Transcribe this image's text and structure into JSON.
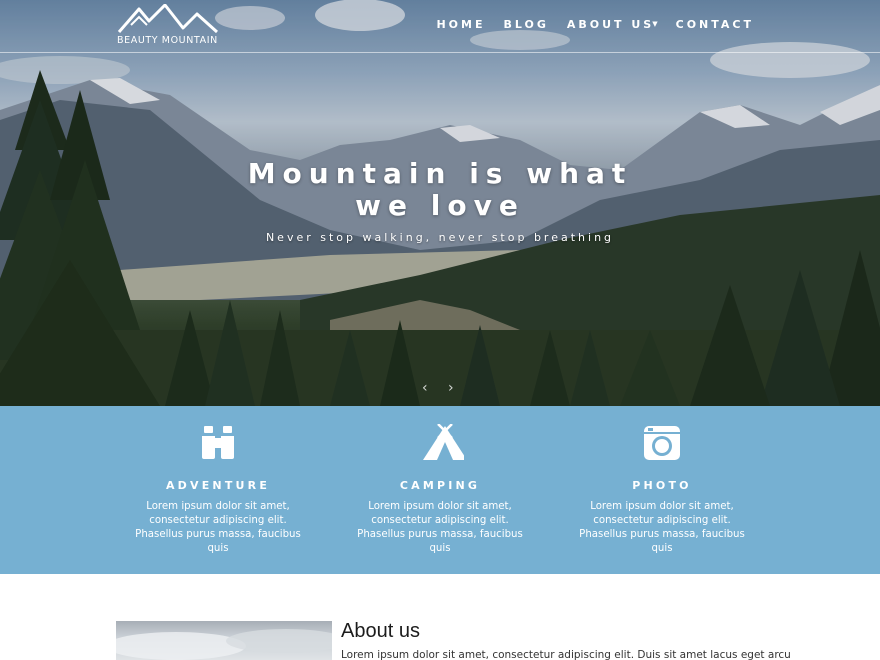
{
  "brand": {
    "name": "BEAUTY MOUNTAIN"
  },
  "nav": {
    "items": [
      {
        "label": "HOME"
      },
      {
        "label": "BLOG"
      },
      {
        "label": "ABOUT US"
      },
      {
        "label": "CONTACT"
      }
    ]
  },
  "hero": {
    "title_line1": "Mountain is what",
    "title_line2": "we love",
    "subtitle": "Never stop walking, never stop breathing",
    "prev_icon": "chevron-left-icon",
    "next_icon": "chevron-right-icon"
  },
  "features": [
    {
      "icon": "binoculars-icon",
      "title": "ADVENTURE",
      "text": "Lorem ipsum dolor sit amet, consectetur adipiscing elit. Phasellus purus massa, faucibus quis"
    },
    {
      "icon": "tent-icon",
      "title": "CAMPING",
      "text": "Lorem ipsum dolor sit amet, consectetur adipiscing elit. Phasellus purus massa, faucibus quis"
    },
    {
      "icon": "camera-icon",
      "title": "PHOTO",
      "text": "Lorem ipsum dolor sit amet, consectetur adipiscing elit. Phasellus purus massa, faucibus quis"
    }
  ],
  "about": {
    "title": "About us",
    "text": "Lorem ipsum dolor sit amet, consectetur adipiscing elit. Duis sit amet lacus eget arcu"
  },
  "colors": {
    "features_bg": "#76b0d2",
    "text_light": "#ffffff"
  }
}
